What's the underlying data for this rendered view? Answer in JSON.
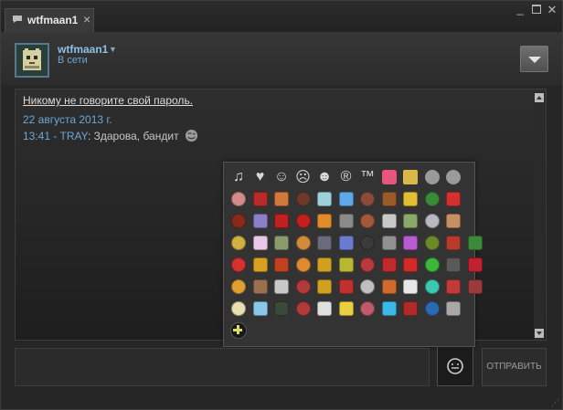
{
  "window": {
    "tab_title": "wtfmaan1",
    "tab_close": "×",
    "min": "_",
    "close": "✕"
  },
  "header": {
    "user_name": "wtfmaan1",
    "status": "В сети",
    "dropdown": "▼"
  },
  "chat": {
    "warning": "Никому не говорите свой пароль.",
    "date": "22 августа 2013 г.",
    "message": {
      "time": "13:41",
      "sep": " - ",
      "sender": "TRAY",
      "colon": ": ",
      "text": "Здарова, бандит"
    }
  },
  "picker": {
    "symbols": [
      "♫",
      "♥",
      "☺",
      "☹",
      "☻",
      "®",
      "™"
    ],
    "colors": {
      "heart": "#e9557a",
      "face_yellow": "#d9b84a",
      "face_gray": "#9a9a9a",
      "row1": [
        "#d38a8a",
        "#b92a2a",
        "#d0793a",
        "#6b3a2a",
        "#9ed0d8",
        "#5fa8e8",
        "#8b4b3a",
        "#9a5a2a",
        "#e0c030",
        "#3a8a3a",
        "#d43030"
      ],
      "row2": [
        "#8a2a1a",
        "#8a80c8",
        "#c02020",
        "#c02020",
        "#e08a2a",
        "#8a8a8a",
        "#a05a3a",
        "#c8c8c8",
        "#8aa86a",
        "#b8b8c0",
        "#c89060"
      ],
      "row3": [
        "#d0b040",
        "#e8c8e8",
        "#8a9a6a",
        "#d08a3a",
        "#6a6a7a",
        "#6a7ad0",
        "#3a3a3a",
        "#909090",
        "#b85ad0",
        "#6a8a2a",
        "#b83a2a",
        "#3a8a3a"
      ],
      "row4": [
        "#d83030",
        "#d8a020",
        "#c04020",
        "#e08a30",
        "#d0a020",
        "#b8b830",
        "#b83a3a",
        "#c02a2a",
        "#d02a2a",
        "#3ab83a",
        "#5a5a5a",
        "#c02030"
      ],
      "row5": [
        "#e0a030",
        "#9a7050",
        "#c8c8c8",
        "#b03a3a",
        "#d0a020",
        "#c03030",
        "#c0c0c0",
        "#d06a2a",
        "#e8e8e8",
        "#3ac8b0",
        "#c03a3a",
        "#9a3a3a"
      ],
      "row6": [
        "#e8e0b0",
        "#8ac8e8",
        "#3a4a3a",
        "#b03a3a",
        "#e0e0e0",
        "#e8d040",
        "#c05a6a",
        "#3ab8e8",
        "#b02a2a",
        "#2a6ab0",
        "#a8a8a8"
      ],
      "row7": [
        "#2a2a2a"
      ]
    }
  },
  "input": {
    "send_label": "ОТПРАВИТЬ"
  }
}
